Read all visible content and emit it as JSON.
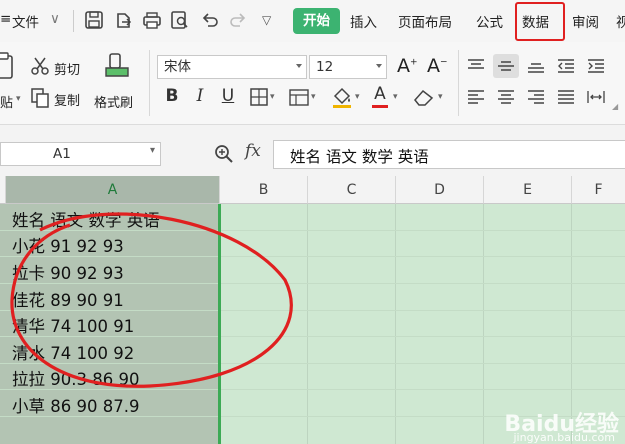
{
  "menubar": {
    "file_label": "文件",
    "tabs": [
      "开始",
      "插入",
      "页面布局",
      "公式",
      "数据",
      "审阅",
      "视"
    ]
  },
  "ribbon": {
    "cut_label": "剪切",
    "paste_label": "贴",
    "copy_label": "复制",
    "format_painter_label": "格式刷",
    "font_name": "宋体",
    "font_size": "12",
    "bold": "B",
    "italic": "I",
    "underline": "U",
    "font_color_letter": "A"
  },
  "formula": {
    "name_box": "A1",
    "fx": "fx",
    "content": "姓名 语文 数学 英语"
  },
  "columns": [
    "A",
    "B",
    "C",
    "D",
    "E",
    "F"
  ],
  "cells": [
    "姓名 语文 数学 英语",
    "小花 91 92 93",
    "拉卡 90 92 93",
    "佳花 89 90 91",
    "清华 74 100 91",
    "清水 74 100 92",
    "拉拉 90.3 86 90",
    "小草 86 90 87.9"
  ],
  "watermark": {
    "brand": "Baidu经验",
    "url": "jingyan.baidu.com"
  },
  "colors": {
    "accent_green": "#3cb371",
    "highlight_red": "#e02020",
    "selection_green": "#cfe8d2"
  }
}
